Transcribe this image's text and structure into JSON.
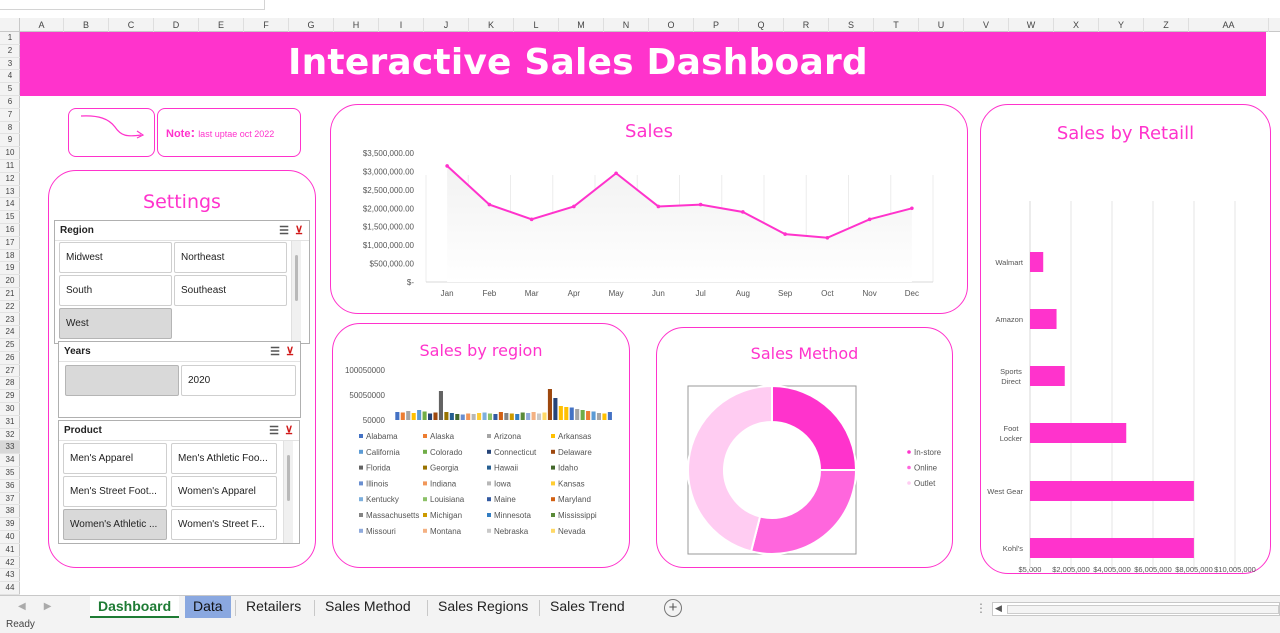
{
  "column_letters": [
    "A",
    "B",
    "C",
    "D",
    "E",
    "F",
    "G",
    "H",
    "I",
    "J",
    "K",
    "L",
    "M",
    "N",
    "O",
    "P",
    "Q",
    "R",
    "S",
    "T",
    "U",
    "V",
    "W",
    "X",
    "Y",
    "Z",
    "AA"
  ],
  "row_numbers": [
    "1",
    "2",
    "3",
    "4",
    "5",
    "6",
    "7",
    "8",
    "9",
    "10",
    "11",
    "12",
    "13",
    "14",
    "15",
    "16",
    "17",
    "18",
    "19",
    "20",
    "21",
    "22",
    "23",
    "24",
    "25",
    "26",
    "27",
    "28",
    "29",
    "30",
    "31",
    "32",
    "33",
    "34",
    "35",
    "36",
    "37",
    "38",
    "39",
    "40",
    "41",
    "42",
    "43",
    "44"
  ],
  "dashboard": {
    "title": "Interactive Sales Dashboard",
    "note_label": "Note",
    "note_colon": ":",
    "note_text": "last uptae oct 2022"
  },
  "settings": {
    "title": "Settings",
    "region": {
      "label": "Region",
      "items": [
        {
          "label": "Midwest",
          "selected": false
        },
        {
          "label": "Northeast",
          "selected": false
        },
        {
          "label": "South",
          "selected": false
        },
        {
          "label": "Southeast",
          "selected": false
        },
        {
          "label": "West",
          "selected": true
        }
      ]
    },
    "years": {
      "label": "Years",
      "items": [
        {
          "label": "",
          "selected": true
        },
        {
          "label": "2020",
          "selected": false
        }
      ]
    },
    "product": {
      "label": "Product",
      "items": [
        {
          "label": "Men's Apparel",
          "selected": false
        },
        {
          "label": "Men's Athletic Foo...",
          "selected": false
        },
        {
          "label": "Men's Street Foot...",
          "selected": false
        },
        {
          "label": "Women's Apparel",
          "selected": false
        },
        {
          "label": "Women's Athletic ...",
          "selected": true
        },
        {
          "label": "Women's Street F...",
          "selected": false
        }
      ]
    }
  },
  "chart_data": [
    {
      "type": "line",
      "title": "Sales",
      "categories": [
        "Jan",
        "Feb",
        "Mar",
        "Apr",
        "May",
        "Jun",
        "Jul",
        "Aug",
        "Sep",
        "Oct",
        "Nov",
        "Dec"
      ],
      "values": [
        3150000,
        2100000,
        1700000,
        2050000,
        2950000,
        2050000,
        2100000,
        1900000,
        1300000,
        1200000,
        1700000,
        2000000
      ],
      "ylim": [
        0,
        3500000
      ],
      "y_ticks": [
        "$-",
        "$500,000.00",
        "$1,000,000.00",
        "$1,500,000.00",
        "$2,000,000.00",
        "$2,500,000.00",
        "$3,000,000.00",
        "$3,500,000.00"
      ],
      "color": "#ff33cc"
    },
    {
      "type": "bar",
      "title": "Sales by Retaill",
      "orientation": "horizontal",
      "categories": [
        "Walmart",
        "Amazon",
        "Sports Direct",
        "Foot Locker",
        "West Gear",
        "Kohl's"
      ],
      "values": [
        650000,
        1300000,
        1700000,
        4700000,
        8000000,
        8000000
      ],
      "x_ticks": [
        "$5,000",
        "$2,005,000",
        "$4,005,000",
        "$6,005,000",
        "$8,005,000",
        "$10,005,000"
      ],
      "xlim": [
        5000,
        10005000
      ],
      "color": "#ff33cc"
    },
    {
      "type": "bar",
      "title": "Sales by region",
      "y_ticks": [
        "50000",
        "50050000",
        "100050000"
      ],
      "ylim": [
        0,
        100050000
      ],
      "values": [
        {
          "name": "Alabama",
          "values": [
            16000000
          ],
          "color": "#4472c4"
        },
        {
          "name": "Alaska",
          "values": [
            15000000
          ],
          "color": "#ed7d31"
        },
        {
          "name": "Arizona",
          "values": [
            18000000
          ],
          "color": "#a5a5a5"
        },
        {
          "name": "Arkansas",
          "values": [
            14000000
          ],
          "color": "#ffc000"
        },
        {
          "name": "California",
          "values": [
            20000000
          ],
          "color": "#5b9bd5"
        },
        {
          "name": "Colorado",
          "values": [
            17000000
          ],
          "color": "#70ad47"
        },
        {
          "name": "Connecticut",
          "values": [
            13000000
          ],
          "color": "#264478"
        },
        {
          "name": "Delaware",
          "values": [
            15000000
          ],
          "color": "#9e480e"
        },
        {
          "name": "Florida",
          "values": [
            58000000
          ],
          "color": "#636363"
        },
        {
          "name": "Georgia",
          "values": [
            16000000
          ],
          "color": "#997300"
        },
        {
          "name": "Hawaii",
          "values": [
            14000000
          ],
          "color": "#255e91"
        },
        {
          "name": "Idaho",
          "values": [
            12000000
          ],
          "color": "#43682b"
        },
        {
          "name": "Illinois",
          "values": [
            11000000
          ],
          "color": "#698ed0"
        },
        {
          "name": "Indiana",
          "values": [
            13000000
          ],
          "color": "#f1975a"
        },
        {
          "name": "Iowa",
          "values": [
            12000000
          ],
          "color": "#b7b7b7"
        },
        {
          "name": "Kansas",
          "values": [
            14000000
          ],
          "color": "#ffcd33"
        },
        {
          "name": "Kentucky",
          "values": [
            15000000
          ],
          "color": "#7cafdd"
        },
        {
          "name": "Louisiana",
          "values": [
            13000000
          ],
          "color": "#8cc168"
        },
        {
          "name": "Maine",
          "values": [
            12000000
          ],
          "color": "#335aa1"
        },
        {
          "name": "Maryland",
          "values": [
            16000000
          ],
          "color": "#d26012"
        },
        {
          "name": "Massachusetts",
          "values": [
            14000000
          ],
          "color": "#848484"
        },
        {
          "name": "Michigan",
          "values": [
            13000000
          ],
          "color": "#cc9a00"
        },
        {
          "name": "Minnesota",
          "values": [
            12000000
          ],
          "color": "#327dc2"
        },
        {
          "name": "Mississippi",
          "values": [
            15000000
          ],
          "color": "#5a8a39"
        },
        {
          "name": "Missouri",
          "values": [
            14000000
          ],
          "color": "#8faadc"
        },
        {
          "name": "Montana",
          "values": [
            16000000
          ],
          "color": "#f4b183"
        },
        {
          "name": "Nebraska",
          "values": [
            13000000
          ],
          "color": "#c9c9c9"
        },
        {
          "name": "Nevada",
          "values": [
            15000000
          ],
          "color": "#ffd966"
        }
      ],
      "extra_visible_bars": [
        {
          "value": 62000000,
          "color": "#9e480e"
        },
        {
          "value": 44000000,
          "color": "#264478"
        },
        {
          "value": 28000000,
          "color": "#ffc000"
        },
        {
          "value": 26000000,
          "color": "#ffc000"
        },
        {
          "value": 25000000,
          "color": "#4472c4"
        },
        {
          "value": 22000000,
          "color": "#a5a5a5"
        },
        {
          "value": 20000000,
          "color": "#70ad47"
        },
        {
          "value": 18000000,
          "color": "#ed7d31"
        },
        {
          "value": 17000000,
          "color": "#5b9bd5"
        },
        {
          "value": 14000000,
          "color": "#a5a5a5"
        },
        {
          "value": 13000000,
          "color": "#ffc000"
        },
        {
          "value": 16000000,
          "color": "#4472c4"
        }
      ]
    },
    {
      "type": "pie",
      "title": "Sales Method",
      "donut": true,
      "series": [
        {
          "name": "In-store",
          "value": 0.25,
          "color": "#ff33cc"
        },
        {
          "name": "Online",
          "value": 0.29,
          "color": "#ff66dd"
        },
        {
          "name": "Outlet",
          "value": 0.46,
          "color": "#ffccf2"
        }
      ]
    }
  ],
  "sheet_tabs": [
    {
      "label": "Dashboard",
      "style": "active"
    },
    {
      "label": "Data",
      "style": "blue"
    },
    {
      "label": "Retailers",
      "style": "normal"
    },
    {
      "label": "Sales Method",
      "style": "normal"
    },
    {
      "label": "Sales Regions",
      "style": "normal"
    },
    {
      "label": "Sales Trend",
      "style": "normal"
    }
  ],
  "status": {
    "text": "Ready"
  }
}
